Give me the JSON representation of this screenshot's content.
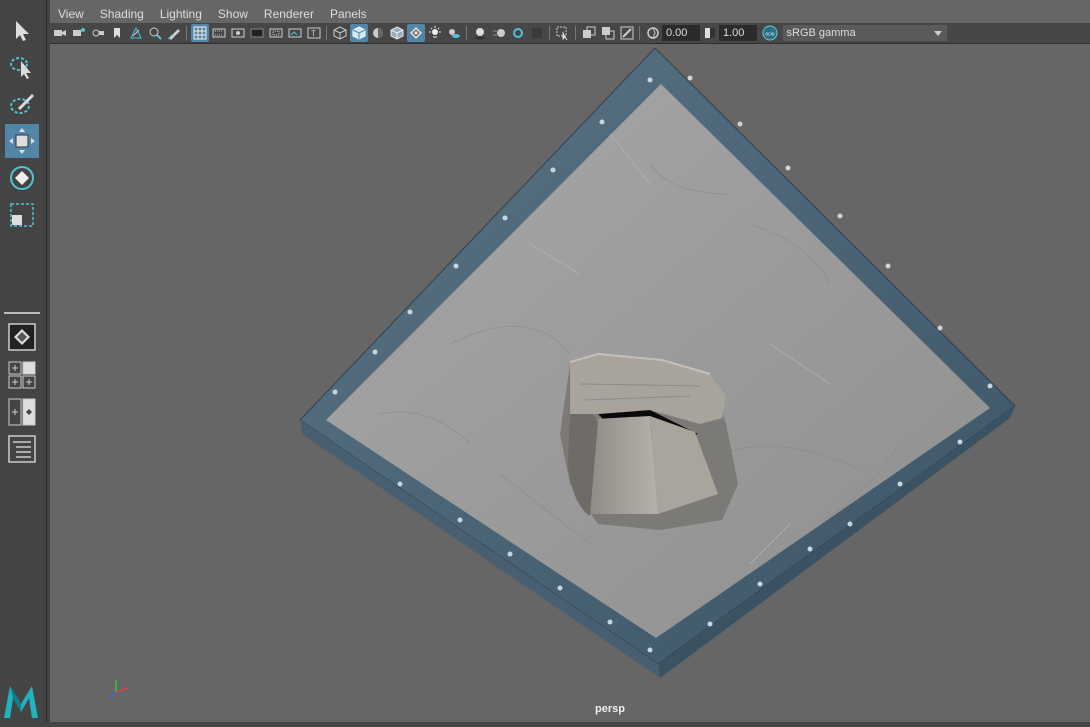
{
  "app": "Autodesk Maya",
  "menu": [
    "View",
    "Shading",
    "Lighting",
    "Show",
    "Renderer",
    "Panels"
  ],
  "toolbox": [
    {
      "name": "select-tool-icon",
      "active": false
    },
    {
      "name": "lasso-tool-icon",
      "active": false
    },
    {
      "name": "paint-select-tool-icon",
      "active": false
    },
    {
      "name": "move-tool-icon",
      "active": true
    },
    {
      "name": "rotate-tool-icon",
      "active": false
    },
    {
      "name": "scale-tool-icon",
      "active": false
    }
  ],
  "layouts": [
    "single-perspective-layout-icon",
    "four-view-layout-icon",
    "two-pane-layout-icon",
    "outliner-layout-icon"
  ],
  "panel_toolbar": {
    "exposure": "0.00",
    "gamma": "1.00",
    "color_management_badge": "ocio",
    "color_space": "sRGB gamma"
  },
  "viewport": {
    "camera_label": "persp",
    "axis": {
      "x": "X",
      "y": "Y",
      "z": "Z"
    },
    "background": "#666666"
  },
  "colors": {
    "accent": "#5285a6",
    "frame": "#4e6a7e",
    "floor": "#9c9c9c"
  }
}
